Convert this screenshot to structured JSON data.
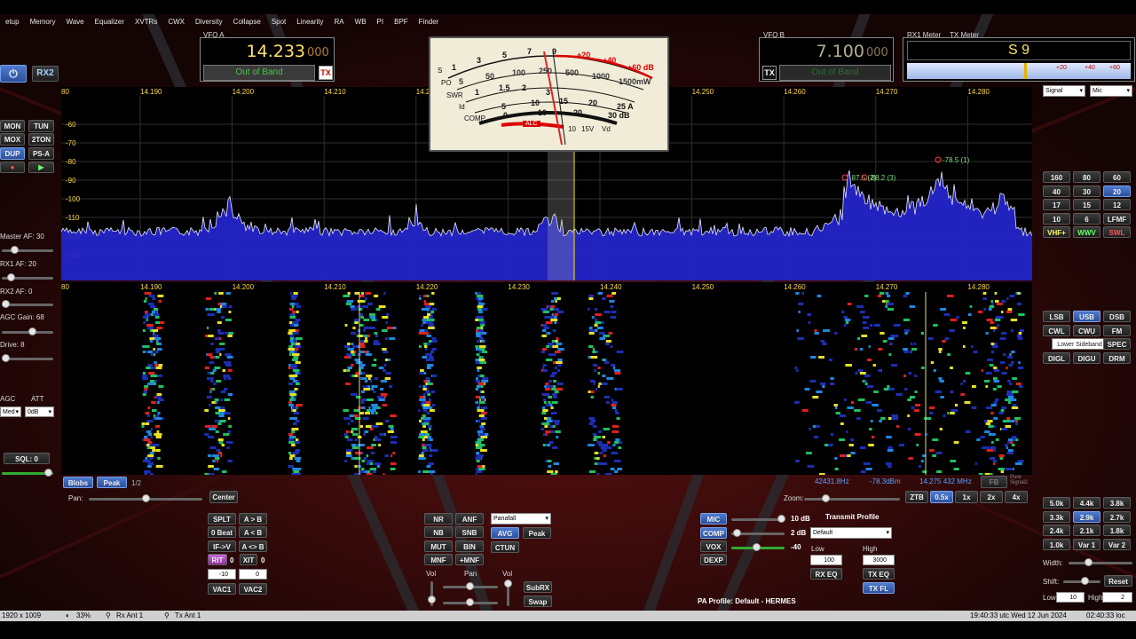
{
  "menu": [
    "etup",
    "Memory",
    "Wave",
    "Equalizer",
    "XVTRs",
    "CWX",
    "Diversity",
    "Collapse",
    "Spot",
    "Linearity",
    "RA",
    "WB",
    "PI",
    "BPF",
    "Finder"
  ],
  "vfo_a": {
    "label": "VFO A",
    "freq_main": "14.233",
    "freq_sub": "000",
    "status": "Out of Band",
    "tx": "TX"
  },
  "vfo_b": {
    "label": "VFO B",
    "freq_main": "7.100",
    "freq_sub": "000",
    "status": "Out of Band",
    "tx": "TX"
  },
  "meters": {
    "rx1_label": "RX1 Meter",
    "tx_label": "TX Meter",
    "reading": "S 9",
    "scale": [
      "+20",
      "+40",
      "+60"
    ]
  },
  "rx2_button": "RX2",
  "left_buttons": {
    "mon": "MON",
    "tun": "TUN",
    "mox": "MOX",
    "two_tone": "2TON",
    "dup": "DUP",
    "psa": "PS-A"
  },
  "left_controls": {
    "master_af": "Master AF:  30",
    "rx1_af": "RX1 AF:  20",
    "rx2_af": "RX2 AF:  0",
    "agc_gain": "AGC Gain:  68",
    "drive": "Drive:  8",
    "agc": "AGC",
    "att": "ATT",
    "agc_value": "Med",
    "att_value": "0dB",
    "sql": "SQL:  0"
  },
  "analog_meter": {
    "s_scale": [
      "1",
      "3",
      "5",
      "7",
      "9",
      "+20",
      "+40",
      "+60 dB"
    ],
    "po_scale": [
      "5",
      "50",
      "100",
      "250",
      "500",
      "1000",
      "1500mW"
    ],
    "swr_scale": [
      "1",
      "1.5",
      "2",
      "3"
    ],
    "row_labels": [
      "S",
      "PO",
      "SWR",
      "Id",
      "COMP"
    ],
    "id_scale": [
      "5",
      "10",
      "15",
      "20",
      "25 A"
    ],
    "comp_scale": [
      "0",
      "10",
      "20",
      "30 dB"
    ],
    "alc": "ALC",
    "vd": [
      "10",
      "15V",
      "Vd"
    ]
  },
  "pan_scale": {
    "freqs": [
      "80",
      "14.190",
      "14.200",
      "14.210",
      "14.220",
      "14.230",
      "14.240",
      "14.250",
      "14.260",
      "14.270",
      "14.280"
    ],
    "dbm": [
      "-60",
      "-70",
      "-80",
      "-90",
      "-100",
      "-110",
      "-120",
      "-130"
    ],
    "markers": [
      "-87.5 (2)",
      "-88.2 (3)",
      "-78.5 (1)"
    ]
  },
  "wf_scale": {
    "freqs": [
      "80",
      "14.190",
      "14.200",
      "14.210",
      "14.220",
      "14.230",
      "14.240",
      "14.250",
      "14.260",
      "14.270",
      "14.280"
    ]
  },
  "readout": {
    "hz": "42431.8Hz",
    "dbm": "-78.3dBm",
    "mhz": "14.275 432 MHz",
    "fb": "FB",
    "pure": "Pure Signal2"
  },
  "right_top_selects": {
    "signal": "Signal",
    "mic": "Mic"
  },
  "bands": [
    "160",
    "80",
    "60",
    "40",
    "30",
    "20",
    "17",
    "15",
    "12",
    "10",
    "6",
    "LFMF",
    "VHF+",
    "WWV",
    "SWL"
  ],
  "modes": [
    "LSB",
    "USB",
    "DSB",
    "CWL",
    "CWU",
    "FM",
    "Lower Sideband",
    "SPEC",
    "DIGL",
    "DIGU",
    "DRM"
  ],
  "filters": [
    "5.0k",
    "4.4k",
    "3.8k",
    "3.3k",
    "2.9k",
    "2.7k",
    "2.4k",
    "2.1k",
    "1.8k",
    "1.0k",
    "Var 1",
    "Var 2"
  ],
  "filter_controls": {
    "width": "Width:",
    "shift": "Shift:",
    "reset": "Reset",
    "low": "Low",
    "low_val": "10",
    "high": "High",
    "high_val": "2"
  },
  "pan_row": {
    "blobs": "Blobs",
    "peak": "Peak",
    "page": "1/2",
    "pan": "Pan:",
    "center": "Center",
    "zoom": "Zoom:",
    "ztb": "ZTB",
    "z05": "0.5x",
    "z1": "1x",
    "z2": "2x",
    "z4": "4x"
  },
  "tx_block": {
    "splt": "SPLT",
    "ab": "A > B",
    "zbeat": "0 Beat",
    "ba": "A < B",
    "ifv": "IF->V",
    "swap": "A <> B",
    "rit": "RIT",
    "rit_val": "0",
    "xit": "XIT",
    "xit_val": "0",
    "spin1": "-10",
    "spin2": "0",
    "vac1": "VAC1",
    "vac2": "VAC2"
  },
  "dsp_block": {
    "nr": "NR",
    "anf": "ANF",
    "nb": "NB",
    "snb": "SNB",
    "mut": "MUT",
    "bin": "BIN",
    "mnf": "MNF",
    "pmnf": "+MNF",
    "panafall": "Panafall",
    "avg": "AVG",
    "peak": "Peak",
    "ctun": "CTUN",
    "vol": "Vol",
    "pan": "Pan",
    "vol2": "Vol",
    "subrx": "SubRX",
    "swap": "Swap"
  },
  "mic_block": {
    "mic": "MIC",
    "comp": "COMP",
    "vox": "VOX",
    "dexp": "DEXP",
    "mic_val": "10 dB",
    "comp_val": "2 dB",
    "vox_val": "-40",
    "profile_label": "Transmit Profile",
    "profile": "Default",
    "low": "Low",
    "high": "High",
    "low_val": "100",
    "high_val": "3000",
    "rxeq": "RX EQ",
    "txeq": "TX EQ",
    "txfl": "TX FL",
    "pa_profile": "PA Profile: Default - HERMES"
  },
  "status": {
    "res": "1920 x 1009",
    "cpu": "33%",
    "rxant": "Rx Ant 1",
    "txant": "Tx Ant 1",
    "utc": "19:40:33 utc  Wed 12 Jun 2024",
    "loc": "02:40:33 loc"
  },
  "colors": {
    "accent": "#3f6fd0",
    "freq_yellow": "#ffe36a",
    "scale_yellow": "#ffd84a",
    "oob_green": "#47c447",
    "spectrum_fill": "#2424c8"
  }
}
